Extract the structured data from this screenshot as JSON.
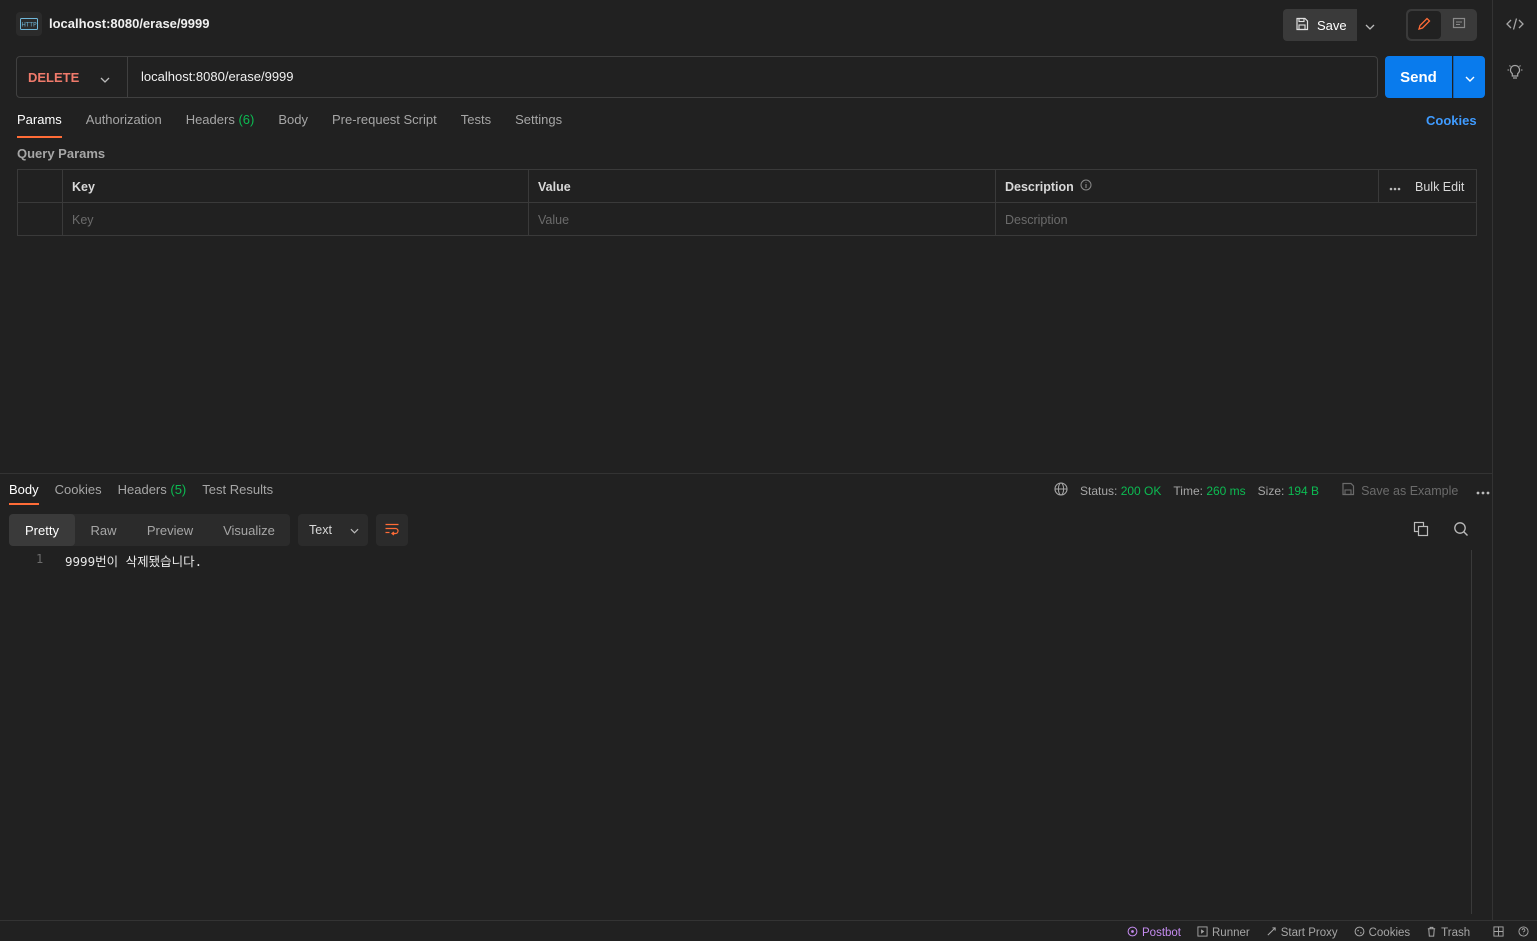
{
  "topbar": {
    "http_badge": "HTTP",
    "tab_title": "localhost:8080/erase/9999",
    "save_label": "Save"
  },
  "request": {
    "method": "DELETE",
    "url": "localhost:8080/erase/9999",
    "send_label": "Send"
  },
  "req_tabs": {
    "params": "Params",
    "authorization": "Authorization",
    "headers": "Headers",
    "headers_count": "(6)",
    "body": "Body",
    "prerequest": "Pre-request Script",
    "tests": "Tests",
    "settings": "Settings",
    "cookies": "Cookies"
  },
  "query_params": {
    "title": "Query Params",
    "col_key": "Key",
    "col_value": "Value",
    "col_description": "Description",
    "bulk_edit": "Bulk Edit",
    "ph_key": "Key",
    "ph_value": "Value",
    "ph_description": "Description"
  },
  "response": {
    "tabs": {
      "body": "Body",
      "cookies": "Cookies",
      "headers": "Headers",
      "headers_count": "(5)",
      "test_results": "Test Results"
    },
    "status_label": "Status:",
    "status_value": "200 OK",
    "time_label": "Time:",
    "time_value": "260 ms",
    "size_label": "Size:",
    "size_value": "194 B",
    "save_example": "Save as Example",
    "format": {
      "pretty": "Pretty",
      "raw": "Raw",
      "preview": "Preview",
      "visualize": "Visualize",
      "text_select": "Text"
    },
    "line_number": "1",
    "body_text": "9999번이 삭제됐습니다."
  },
  "statusbar": {
    "postbot": "Postbot",
    "runner": "Runner",
    "start_proxy": "Start Proxy",
    "cookies": "Cookies",
    "trash": "Trash"
  },
  "colors": {
    "accent_orange": "#ff6c37",
    "send_blue": "#097bed",
    "method_delete": "#f07a6b",
    "success_green": "#0cbb52",
    "link_blue": "#3f9bff",
    "postbot_purple": "#c58cf0"
  },
  "icons": [
    "http-icon",
    "save-icon",
    "chevron-down-icon",
    "pencil-icon",
    "comment-icon",
    "code-icon",
    "lightbulb-icon",
    "info-icon",
    "ellipsis-icon",
    "globe-icon",
    "wrap-lines-icon",
    "copy-icon",
    "search-icon",
    "postbot-icon",
    "runner-icon",
    "proxy-icon",
    "cookie-icon",
    "trash-icon",
    "layout-icon",
    "help-icon"
  ]
}
